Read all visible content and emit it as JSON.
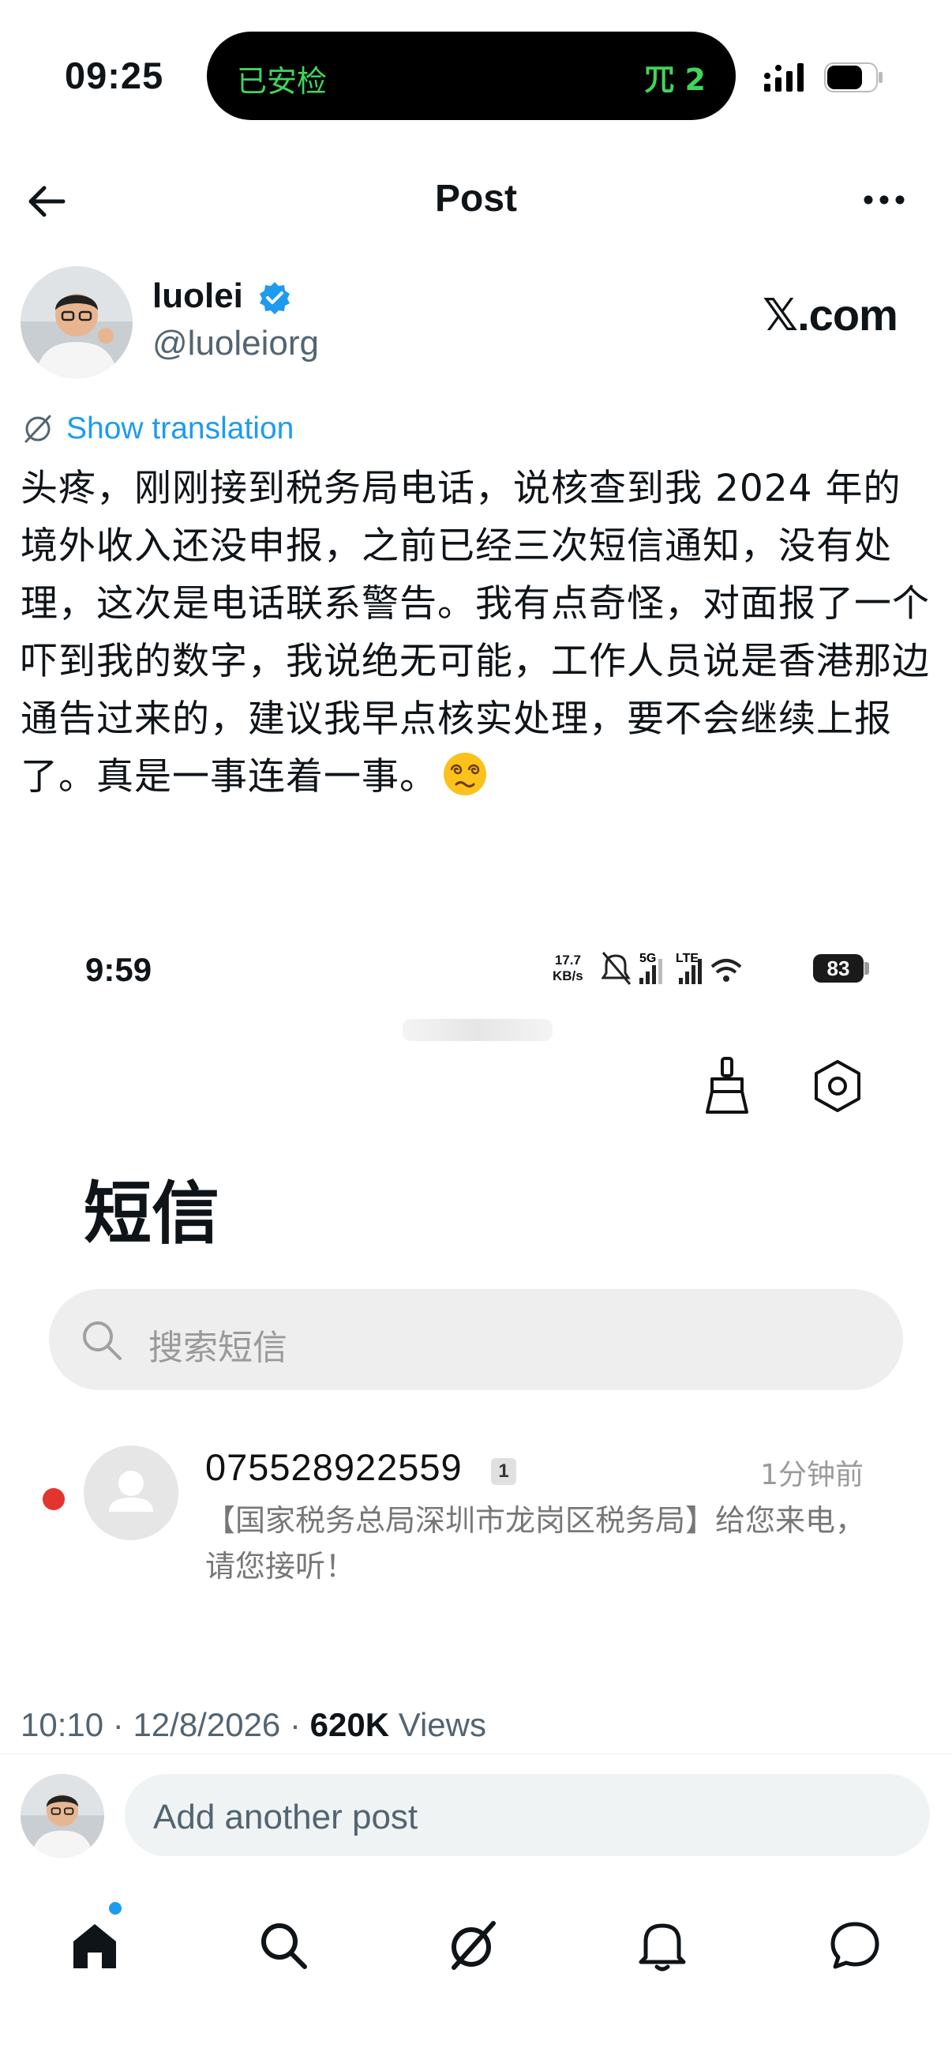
{
  "status_bar": {
    "time": "09:25",
    "island_left": "已安检",
    "island_right": "⺴ 2"
  },
  "header": {
    "title": "Post"
  },
  "author": {
    "name": "luolei",
    "handle": "@luoleiorg",
    "verified": true,
    "site": "𝕏.com"
  },
  "post": {
    "show_translation": "Show translation",
    "text": "头疼，刚刚接到税务局电话，说核查到我 2024 年的境外收入还没申报，之前已经三次短信通知，没有处理，这次是电话联系警告。我有点奇怪，对面报了一个吓到我的数字，我说绝无可能，工作人员说是香港那边通告过来的，建议我早点核实处理，要不会继续上报了。真是一事连着一事。",
    "emoji": "dizzy-face-emoji"
  },
  "embedded_screenshot": {
    "time": "9:59",
    "net_speed": "17.7\nKB/s",
    "battery": "83",
    "title": "短信",
    "search_placeholder": "搜索短信",
    "message": {
      "number": "075528922559",
      "count": "1",
      "time": "1分钟前",
      "body": "【国家税务总局深圳市龙岗区税务局】给您来电，请您接听！",
      "unread": true
    }
  },
  "meta": {
    "time": "10:10",
    "date": "12/8/2026",
    "views_count": "620K",
    "views_label": "Views"
  },
  "reply": {
    "placeholder": "Add another post"
  },
  "nav": {
    "items": [
      "home-icon",
      "search-icon",
      "grok-icon",
      "notifications-icon",
      "messages-icon"
    ],
    "active": "home-icon"
  },
  "colors": {
    "accent": "#1d9bf0",
    "text_secondary": "#536471",
    "island_green": "#3fd65a",
    "unread_red": "#e3342f"
  }
}
